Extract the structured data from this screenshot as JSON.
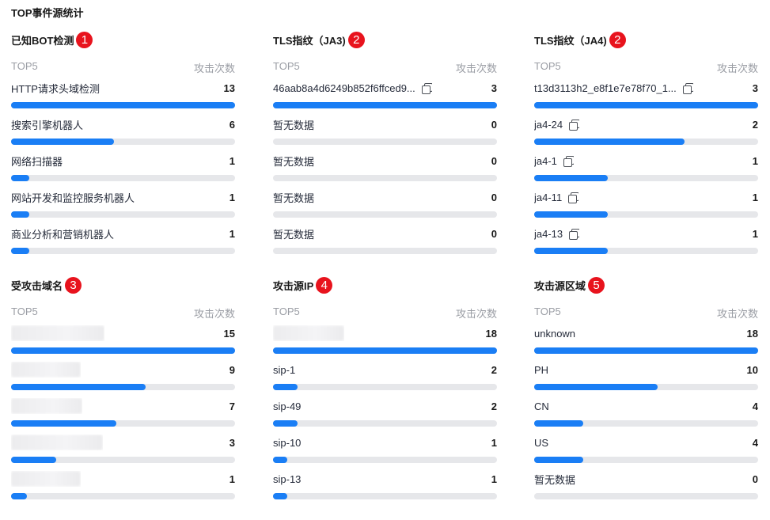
{
  "page": {
    "title": "TOP事件源统计"
  },
  "panels": [
    {
      "title": "已知BOT检测",
      "badge": "1",
      "col_left": "TOP5",
      "col_right": "攻击次数",
      "rows": [
        {
          "label": "HTTP请求头域检测",
          "count": "13",
          "ratio": 1.0
        },
        {
          "label": "搜索引擎机器人",
          "count": "6",
          "ratio": 0.46
        },
        {
          "label": "网络扫描器",
          "count": "1",
          "ratio": 0.08
        },
        {
          "label": "网站开发和监控服务机器人",
          "count": "1",
          "ratio": 0.08
        },
        {
          "label": "商业分析和营销机器人",
          "count": "1",
          "ratio": 0.08
        }
      ]
    },
    {
      "title": "TLS指纹（JA3)",
      "badge": "2",
      "col_left": "TOP5",
      "col_right": "攻击次数",
      "rows": [
        {
          "label": "46aab8a4d6249b852f6ffced9...",
          "count": "3",
          "ratio": 1.0,
          "copy": true
        },
        {
          "label": "暂无数据",
          "count": "0",
          "ratio": 0
        },
        {
          "label": "暂无数据",
          "count": "0",
          "ratio": 0
        },
        {
          "label": "暂无数据",
          "count": "0",
          "ratio": 0
        },
        {
          "label": "暂无数据",
          "count": "0",
          "ratio": 0
        }
      ]
    },
    {
      "title": "TLS指纹（JA4)",
      "badge": "2",
      "col_left": "TOP5",
      "col_right": "攻击次数",
      "rows": [
        {
          "label": "t13d3113h2_e8f1e7e78f70_1...",
          "count": "3",
          "ratio": 1.0,
          "copy": true
        },
        {
          "label": "ja4-24",
          "count": "2",
          "ratio": 0.67,
          "copy": true
        },
        {
          "label": "ja4-1",
          "count": "1",
          "ratio": 0.33,
          "copy": true
        },
        {
          "label": "ja4-11",
          "count": "1",
          "ratio": 0.33,
          "copy": true
        },
        {
          "label": "ja4-13",
          "count": "1",
          "ratio": 0.33,
          "copy": true
        }
      ]
    },
    {
      "title": "受攻击域名",
      "badge": "3",
      "col_left": "TOP5",
      "col_right": "攻击次数",
      "rows": [
        {
          "label": "",
          "count": "15",
          "ratio": 1.0,
          "blur": 118
        },
        {
          "label": "",
          "count": "9",
          "ratio": 0.6,
          "blur": 88
        },
        {
          "label": "",
          "count": "7",
          "ratio": 0.47,
          "blur": 90
        },
        {
          "label": "",
          "count": "3",
          "ratio": 0.2,
          "blur": 116
        },
        {
          "label": "",
          "count": "1",
          "ratio": 0.07,
          "blur": 88
        }
      ]
    },
    {
      "title": "攻击源IP",
      "badge": "4",
      "col_left": "TOP5",
      "col_right": "攻击次数",
      "rows": [
        {
          "label": "",
          "count": "18",
          "ratio": 1.0,
          "blur": 90
        },
        {
          "label": "sip-1",
          "count": "2",
          "ratio": 0.11
        },
        {
          "label": "sip-49",
          "count": "2",
          "ratio": 0.11
        },
        {
          "label": "sip-10",
          "count": "1",
          "ratio": 0.055
        },
        {
          "label": "sip-13",
          "count": "1",
          "ratio": 0.055
        }
      ]
    },
    {
      "title": "攻击源区域",
      "badge": "5",
      "col_left": "TOP5",
      "col_right": "攻击次数",
      "rows": [
        {
          "label": "unknown",
          "count": "18",
          "ratio": 1.0
        },
        {
          "label": "PH",
          "count": "10",
          "ratio": 0.55
        },
        {
          "label": "CN",
          "count": "4",
          "ratio": 0.22
        },
        {
          "label": "US",
          "count": "4",
          "ratio": 0.22
        },
        {
          "label": "暂无数据",
          "count": "0",
          "ratio": 0
        }
      ]
    }
  ]
}
